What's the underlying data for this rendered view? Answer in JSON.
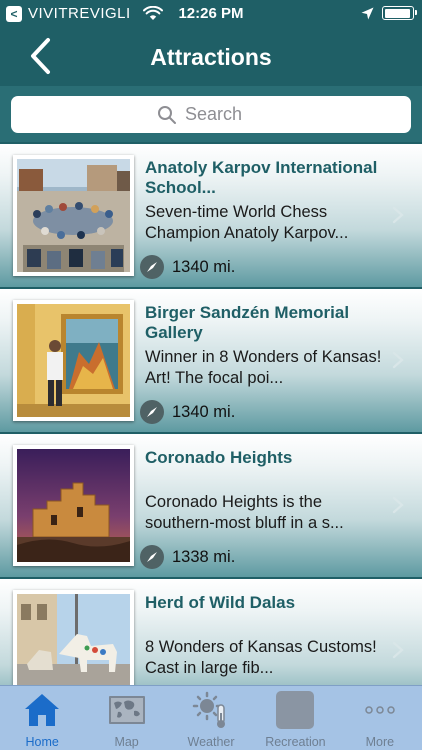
{
  "status_bar": {
    "back_app_glyph": "<",
    "carrier": "VIVITREVIGLI",
    "time": "12:26 PM",
    "battery_level": 0.95
  },
  "nav": {
    "title": "Attractions",
    "back_icon": "chevron-left-icon"
  },
  "search": {
    "placeholder": "Search"
  },
  "attractions": [
    {
      "title": "Anatoly Karpov International School...",
      "description": "Seven-time World Chess Champion Anatoly Karpov...",
      "distance": "1340 mi."
    },
    {
      "title": "Birger Sandzén Memorial Gallery",
      "description": "Winner in 8 Wonders of Kansas! Art! The focal poi...",
      "distance": "1340 mi."
    },
    {
      "title": "Coronado Heights",
      "description": "Coronado Heights is the southern-most bluff in a s...",
      "distance": "1338 mi."
    },
    {
      "title": "Herd of Wild Dalas",
      "description": "8 Wonders of Kansas Customs! Cast in large fib...",
      "distance": ""
    }
  ],
  "tabs": [
    {
      "label": "Home",
      "icon": "home-icon",
      "active": true
    },
    {
      "label": "Map",
      "icon": "map-icon",
      "active": false
    },
    {
      "label": "Weather",
      "icon": "weather-icon",
      "active": false
    },
    {
      "label": "Recreation",
      "icon": "recreation-icon",
      "active": false
    },
    {
      "label": "More",
      "icon": "more-icon",
      "active": false
    }
  ],
  "colors": {
    "header": "#1f5f66",
    "title_text": "#1f5f66",
    "tab_bar": "#a5c3e5",
    "tab_active": "#1b6cc9"
  }
}
